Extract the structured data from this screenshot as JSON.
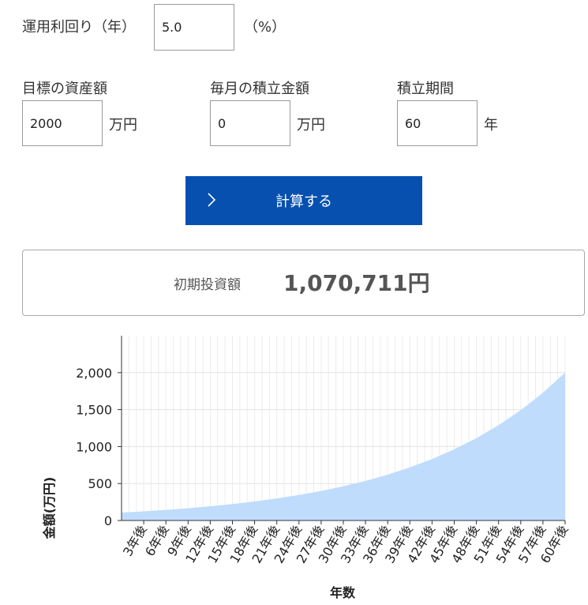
{
  "form": {
    "rate_label": "運用利回り（年）",
    "rate_value": "5.0",
    "rate_unit": "（%）",
    "target_label": "目標の資産額",
    "target_value": "2000",
    "target_unit": "万円",
    "monthly_label": "毎月の積立金額",
    "monthly_value": "0",
    "monthly_unit": "万円",
    "period_label": "積立期間",
    "period_value": "60",
    "period_unit": "年"
  },
  "button": {
    "calc_label": "計算する",
    "icon": "chevron-right-icon"
  },
  "result": {
    "label": "初期投資額",
    "value": "1,070,711円"
  },
  "chart_data": {
    "type": "area",
    "xlabel": "年数",
    "ylabel": "金額(万円)",
    "categories": [
      "3年後",
      "6年後",
      "9年後",
      "12年後",
      "15年後",
      "18年後",
      "21年後",
      "24年後",
      "27年後",
      "30年後",
      "33年後",
      "36年後",
      "39年後",
      "42年後",
      "45年後",
      "48年後",
      "51年後",
      "54年後",
      "57年後",
      "60年後"
    ],
    "x": [
      0,
      3,
      6,
      9,
      12,
      15,
      18,
      21,
      24,
      27,
      30,
      33,
      36,
      39,
      42,
      45,
      48,
      51,
      54,
      57,
      60
    ],
    "values": [
      107.1,
      124.0,
      143.5,
      166.1,
      192.3,
      222.6,
      257.7,
      298.4,
      345.4,
      399.8,
      462.8,
      535.8,
      620.3,
      718.1,
      831.3,
      962.3,
      1114.0,
      1289.5,
      1492.8,
      1728.1,
      2000.0
    ],
    "yticks": [
      0,
      500,
      1000,
      1500,
      2000
    ],
    "ytick_labels": [
      "0",
      "500",
      "1,000",
      "1,500",
      "2,000"
    ],
    "ylim": [
      0,
      2500
    ],
    "xlim": [
      0,
      60
    ],
    "grid": true,
    "fill_color": "#bfdcfc"
  }
}
